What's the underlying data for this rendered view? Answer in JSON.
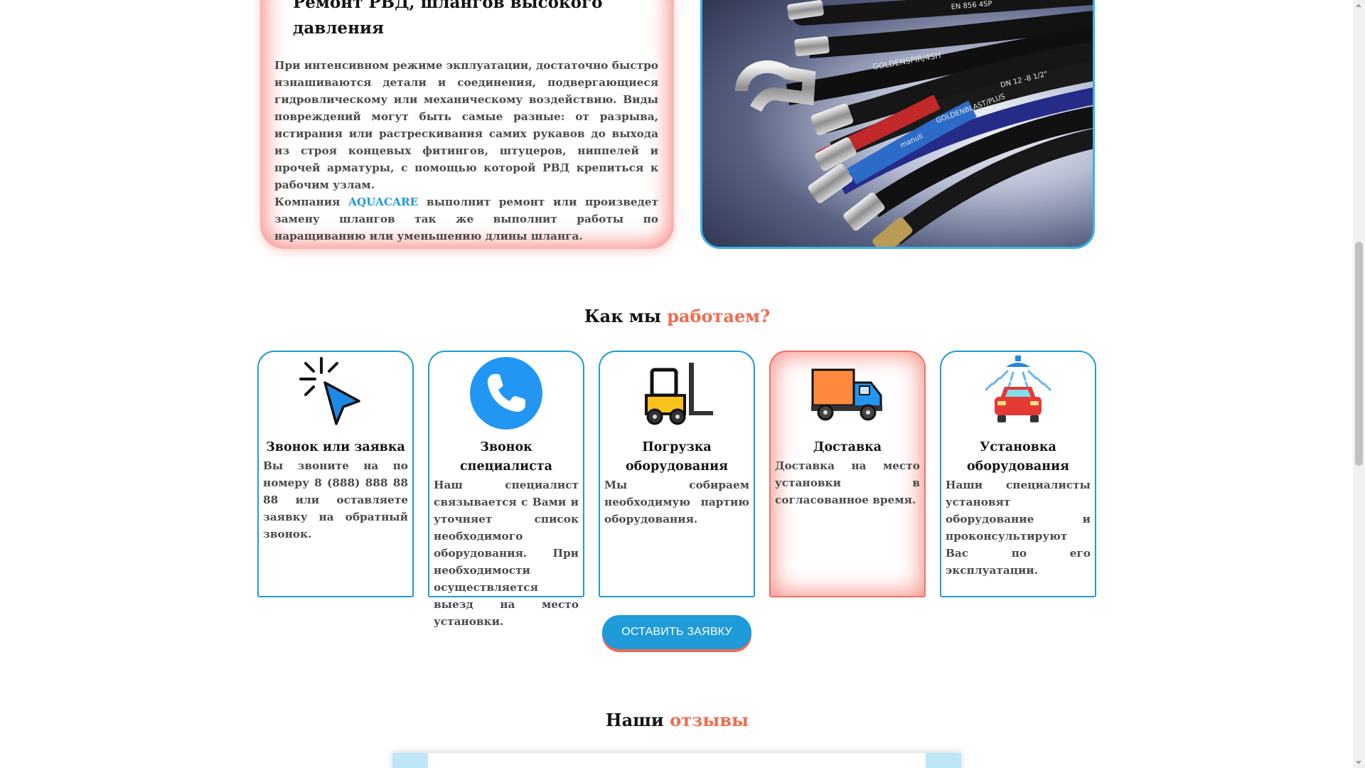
{
  "repair": {
    "title": "Ремонт РВД, шлангов высокого давления",
    "paragraph1": "При интенсивном режиме экплуатации, достаточно быстро изнашиваются детали и соединения, подвергающиеся гидровлическому или механическому воздействию. Виды повреждений могут быть самые разные: от разрыва, истирания или растрескивания самих рукавов до выхода из строя концевых фитингов, штуцеров, ниппелей и прочей арматуры, с помощью которой РВД крепиться к рабочим узлам.",
    "paragraph2_before": "Компания ",
    "brand": "AQUACARE",
    "paragraph2_after": " выполнит ремонт или произведет замену шлангов так же выполнит работы по наращиванию или уменьшению длины шланга.",
    "image": "hydraulic-hoses-photo",
    "hose_prints": [
      "EN 856 4SP",
      "GOLDENSPIR/4SH",
      "DN 12 -8 1/2\"",
      "GOLDENBLAST/PLUS",
      "manuli"
    ]
  },
  "how": {
    "title_plain": "Как мы ",
    "title_accent": "работаем?",
    "steps": [
      {
        "icon": "cursor-click-icon",
        "title": "Звонок или заявка",
        "text": "Вы звоните на по номеру 8 (888) 888 88 88 или оставляете заявку на обратный звонок."
      },
      {
        "icon": "phone-icon",
        "title": "Звонок специалиста",
        "text": "Наш специалист связывается с Вами и уточняет список необходимого оборудования. При необходимости осуществляется выезд на место установки."
      },
      {
        "icon": "forklift-icon",
        "title": "Погрузка оборудования",
        "text": "Мы собираем необходимую партию оборудования."
      },
      {
        "icon": "delivery-truck-icon",
        "title": "Доставка",
        "text": "Доставка на место установки в согласованное время."
      },
      {
        "icon": "car-wash-icon",
        "title": "Установка оборудования",
        "text": "Наши специалисты установят оборудование и проконсультируют Вас по его эксплуатации."
      }
    ],
    "cta_label": "ОСТАВИТЬ ЗАЯВКУ"
  },
  "reviews": {
    "title_plain": "Наши ",
    "title_accent": "отзывы"
  },
  "colors": {
    "accent_blue": "#1e9bd8",
    "accent_red": "#f26a4f",
    "text_dark": "#141414",
    "text_body": "#4a4a4a"
  }
}
